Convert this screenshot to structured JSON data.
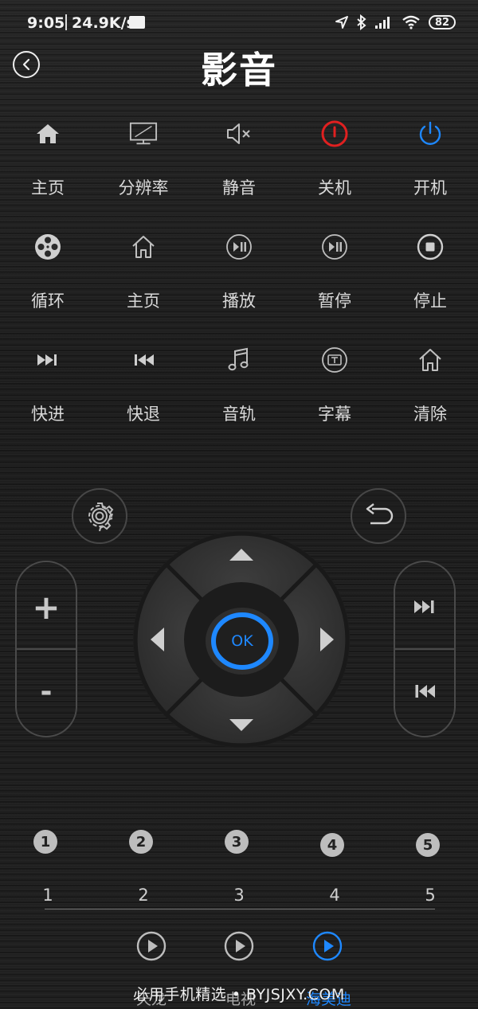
{
  "status_bar": {
    "time": "9:05",
    "speed": "24.9K/s",
    "battery": "82",
    "icons": [
      "location-icon",
      "bluetooth-icon",
      "signal-icon",
      "wifi-icon",
      "battery-icon"
    ]
  },
  "header": {
    "title": "影音",
    "back_icon": "back-icon"
  },
  "functions": [
    {
      "label": "主页",
      "icon": "home-filled-icon"
    },
    {
      "label": "分辨率",
      "icon": "screen-icon"
    },
    {
      "label": "静音",
      "icon": "mute-icon"
    },
    {
      "label": "关机",
      "icon": "power-off-icon",
      "color": "#e02020"
    },
    {
      "label": "开机",
      "icon": "power-on-icon",
      "color": "#1e88ff"
    },
    {
      "label": "循环",
      "icon": "loop-reel-icon"
    },
    {
      "label": "主页",
      "icon": "home-outline-icon"
    },
    {
      "label": "播放",
      "icon": "play-pause-icon"
    },
    {
      "label": "暂停",
      "icon": "play-pause-icon"
    },
    {
      "label": "停止",
      "icon": "stop-icon"
    },
    {
      "label": "快进",
      "icon": "fast-forward-icon"
    },
    {
      "label": "快退",
      "icon": "rewind-icon"
    },
    {
      "label": "音轨",
      "icon": "music-note-icon"
    },
    {
      "label": "字幕",
      "icon": "subtitle-icon"
    },
    {
      "label": "清除",
      "icon": "home-outline-icon"
    }
  ],
  "controls": {
    "volume_up": "+",
    "volume_down": "-",
    "ok_label": "OK",
    "accent_color": "#1e88ff"
  },
  "numbers": {
    "badges": [
      "1",
      "2",
      "3",
      "4",
      "5"
    ],
    "labels": [
      "1",
      "2",
      "3",
      "4",
      "5"
    ]
  },
  "tabs": [
    {
      "label": "天龙",
      "active": false
    },
    {
      "label": "电视",
      "active": false
    },
    {
      "label": "海美迪",
      "active": true
    }
  ],
  "watermark": "必用手机精选 • BYJSJXY.COM"
}
